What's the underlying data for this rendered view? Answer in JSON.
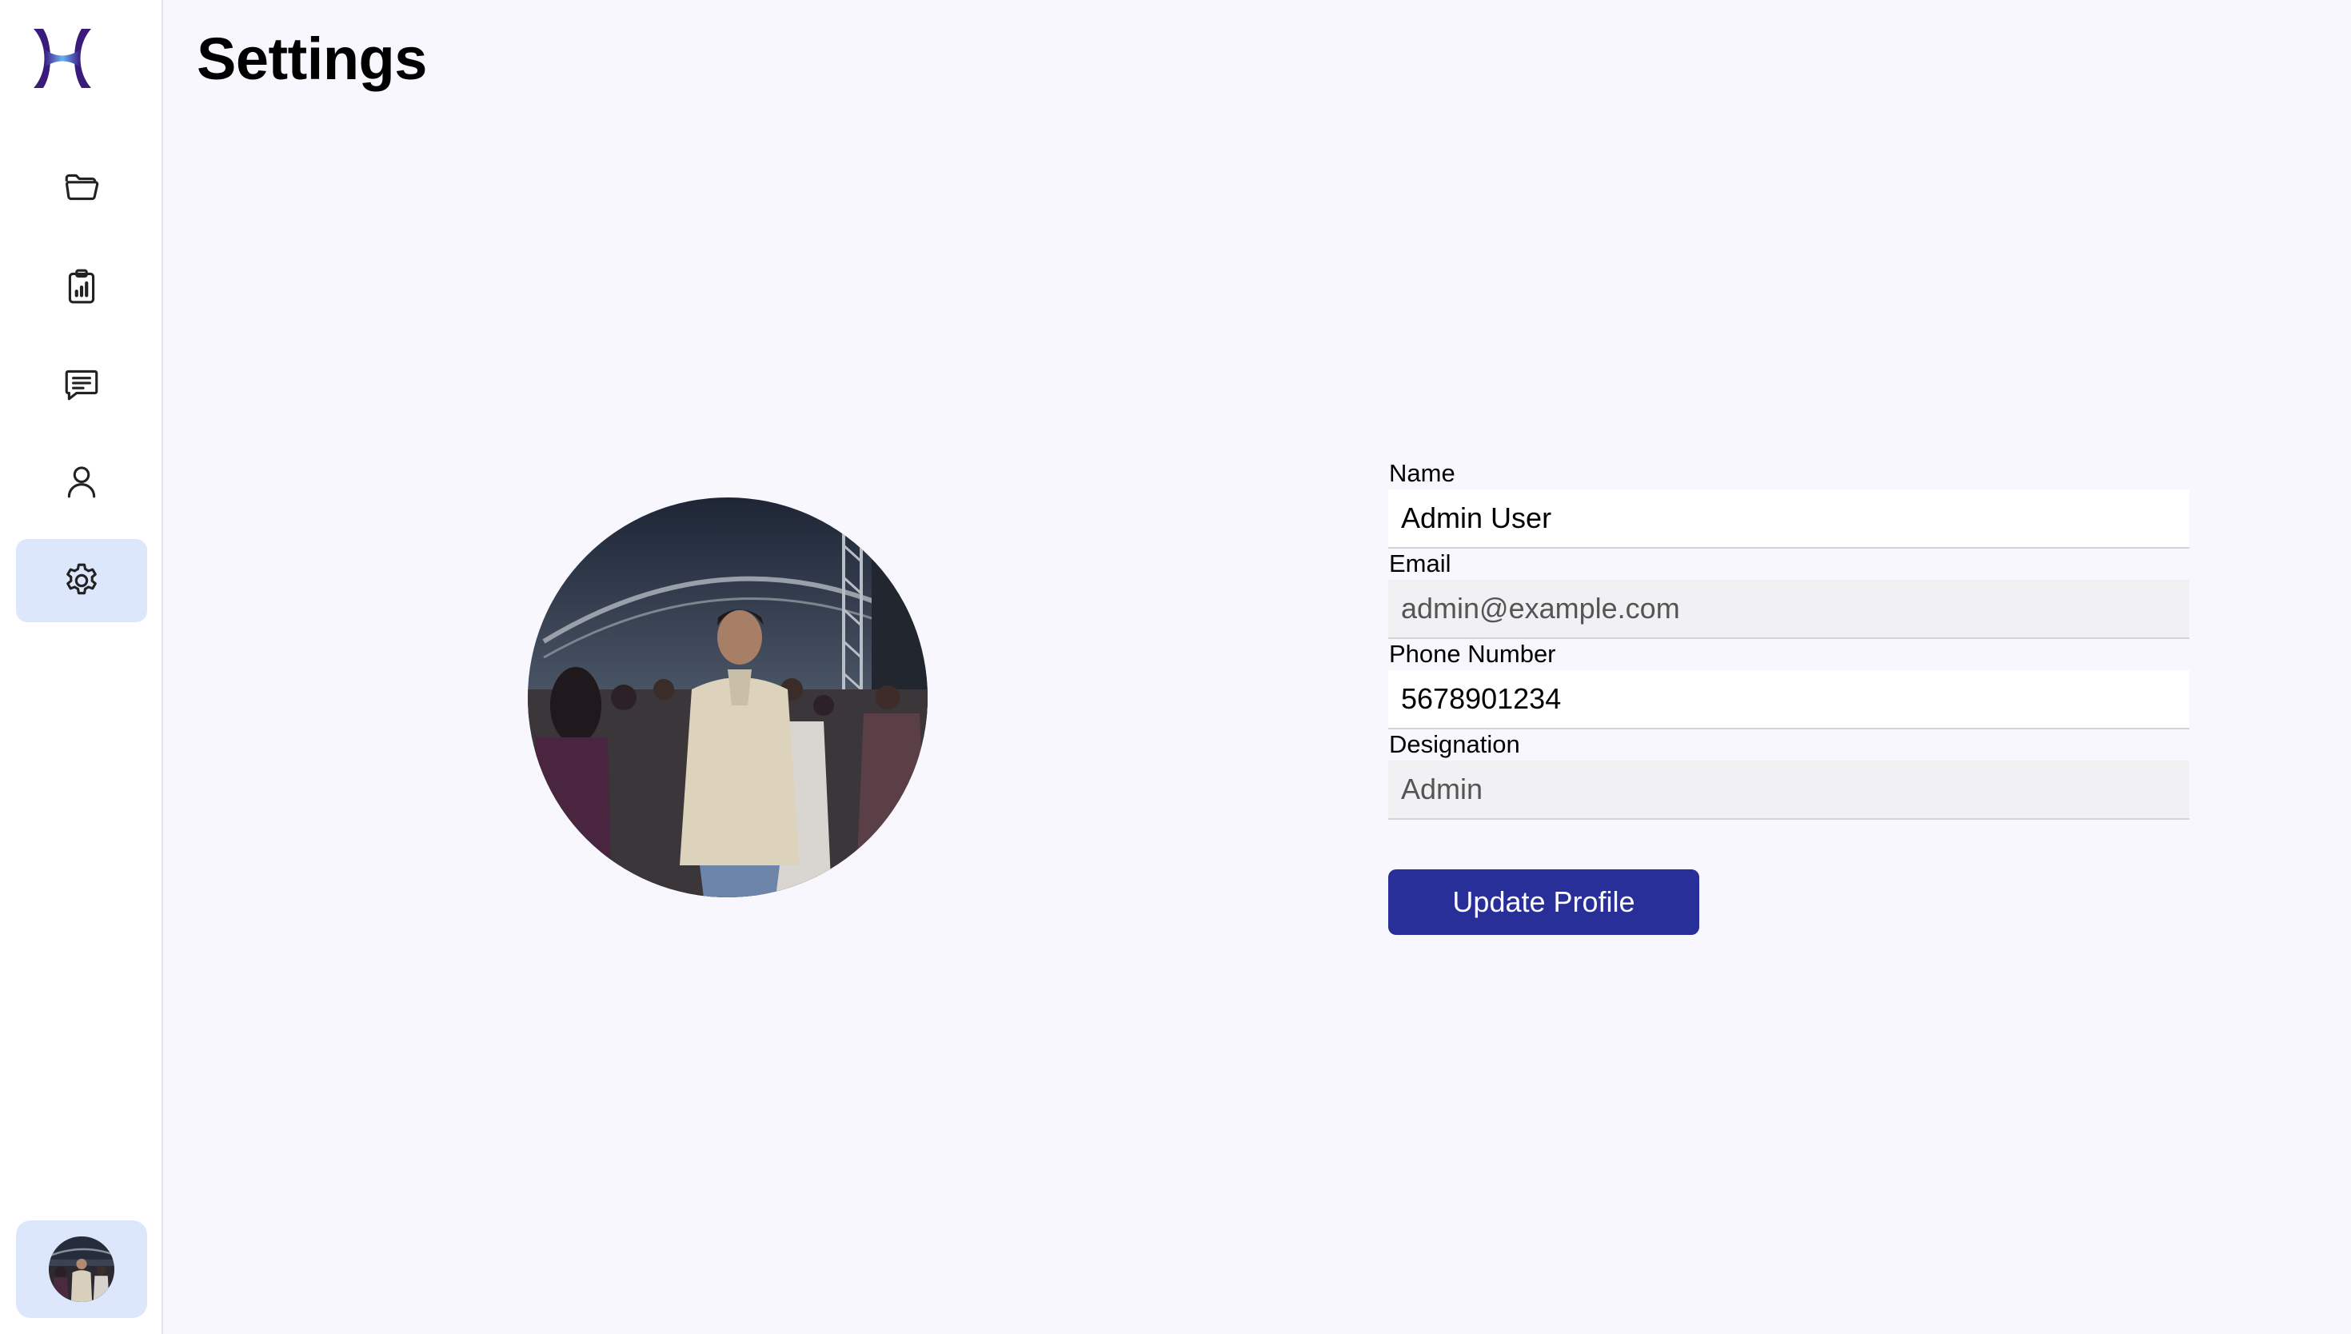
{
  "page": {
    "title": "Settings"
  },
  "sidebar": {
    "logo_icon": "app-logo-x",
    "items": [
      {
        "id": "files",
        "icon": "folder-icon",
        "active": false
      },
      {
        "id": "reports",
        "icon": "clipboard-chart-icon",
        "active": false
      },
      {
        "id": "messages",
        "icon": "message-icon",
        "active": false
      },
      {
        "id": "users",
        "icon": "user-icon",
        "active": false
      },
      {
        "id": "settings",
        "icon": "gear-icon",
        "active": true
      }
    ],
    "profile_avatar": "user-avatar-photo"
  },
  "profile": {
    "photo": "profile-photo",
    "fields": {
      "name": {
        "label": "Name",
        "value": "Admin User",
        "editable": true
      },
      "email": {
        "label": "Email",
        "value": "admin@example.com",
        "editable": false
      },
      "phone": {
        "label": "Phone Number",
        "value": "5678901234",
        "editable": true
      },
      "designation": {
        "label": "Designation",
        "value": "Admin",
        "editable": false
      }
    },
    "update_button_label": "Update Profile"
  },
  "colors": {
    "background": "#f8f7fd",
    "sidebar": "#ffffff",
    "active_nav": "#dde7fb",
    "primary_button": "#292f99",
    "logo_dark": "#3a1a7a",
    "logo_light": "#6aa6f0"
  }
}
